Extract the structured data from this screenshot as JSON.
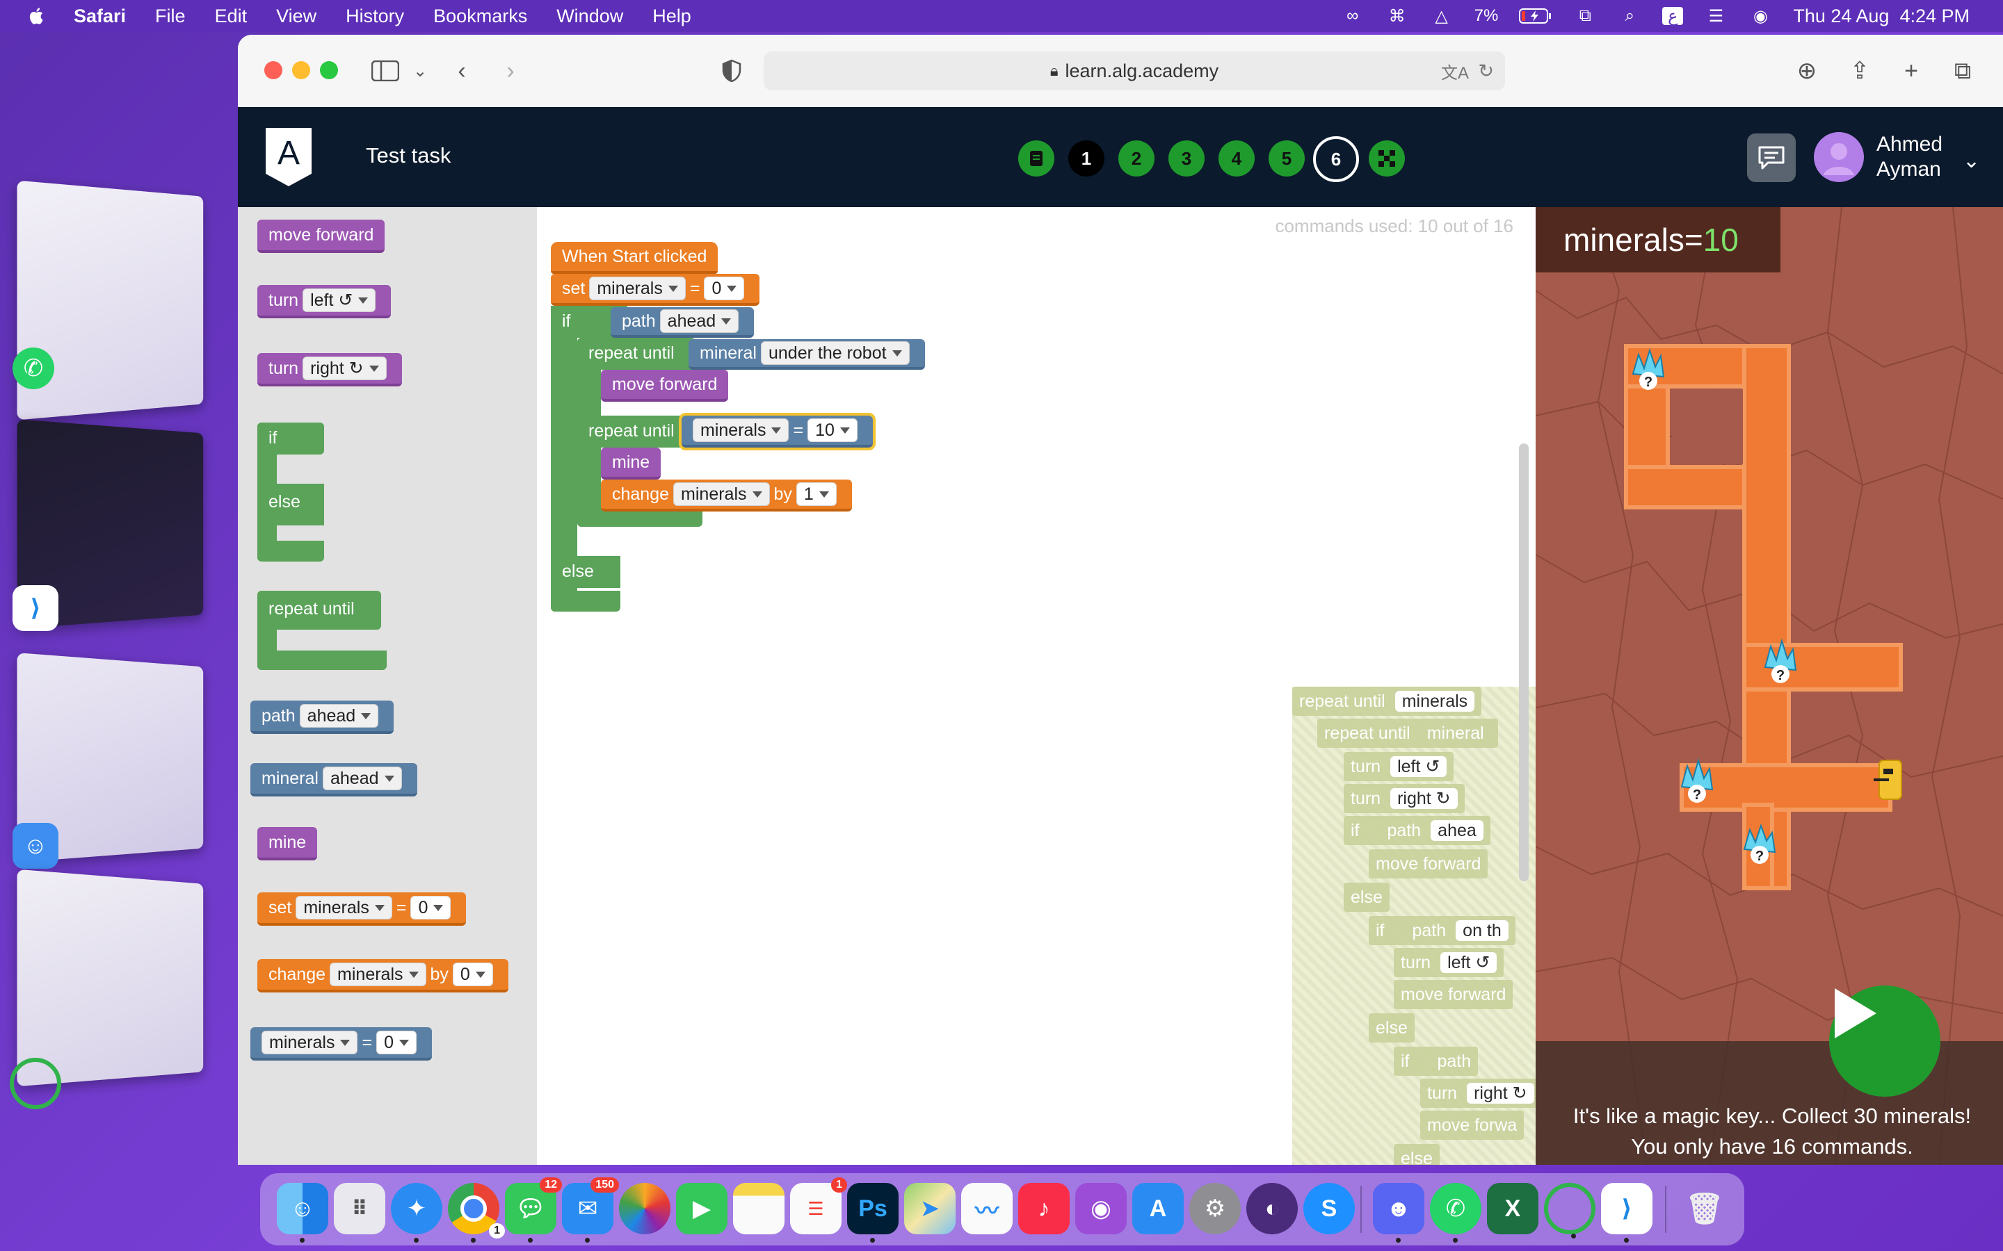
{
  "menubar": {
    "app": "Safari",
    "items": [
      "File",
      "Edit",
      "View",
      "History",
      "Bookmarks",
      "Window",
      "Help"
    ],
    "battery": "7%",
    "datetime": "Thu 24 Aug  4:24 PM"
  },
  "browser": {
    "url": "learn.alg.academy"
  },
  "site": {
    "task_title": "Test task",
    "steps": [
      "1",
      "2",
      "3",
      "4",
      "5",
      "6"
    ],
    "user_first": "Ahmed",
    "user_last": "Ayman"
  },
  "toolbox": {
    "move_forward": "move forward",
    "turn": "turn",
    "left": "left ↺",
    "right": "right ↻",
    "if": "if",
    "else": "else",
    "repeat_until": "repeat until",
    "path": "path",
    "ahead": "ahead",
    "mineral": "mineral",
    "mine": "mine",
    "set": "set",
    "minerals": "minerals",
    "eq": "=",
    "zero": "0",
    "change": "change",
    "by": "by"
  },
  "workspace": {
    "commands_used": "commands used: 10 out of 16",
    "when_start": "When Start clicked",
    "set": "set",
    "minerals": "minerals",
    "eq": "=",
    "zero": "0",
    "if": "if",
    "path": "path",
    "ahead": "ahead",
    "repeat_until": "repeat until",
    "mineral": "mineral",
    "under_robot": "under the robot",
    "move_forward": "move forward",
    "ten": "10",
    "mine": "mine",
    "change": "change",
    "by": "by",
    "one": "1",
    "else": "else",
    "ghost": {
      "l1": "repeat until",
      "l1dd": "minerals",
      "l2": "repeat until",
      "l2b": "mineral",
      "l3": "turn",
      "l3dd": "left ↺",
      "l4": "turn",
      "l4dd": "right ↻",
      "l5": "if",
      "l5b": "path",
      "l5dd": "ahea",
      "l6": "move forward",
      "l7": "else",
      "l8": "if",
      "l8b": "path",
      "l8dd": "on th",
      "l9": "turn",
      "l9dd": "left ↺",
      "l10": "move forward",
      "l11": "else",
      "l12": "if",
      "l12b": "path",
      "l13": "turn",
      "l13dd": "right ↻",
      "l14": "move forwa",
      "l15": "else"
    }
  },
  "game": {
    "counter_label": "minerals=",
    "counter_value": "10",
    "hint": "It's like a magic key... Collect 30 minerals! You only have 16 commands."
  },
  "colors": {
    "accent_green": "#1f9b2d",
    "header_bg": "#0b1a2c",
    "game_bg": "#a65a4b",
    "path_orange": "#f07a34"
  },
  "dock": {
    "mail_badge": "150",
    "messages_badge": "12",
    "reminders_badge": "1",
    "chrome_badge": "1",
    "ps_label": "Ps"
  }
}
